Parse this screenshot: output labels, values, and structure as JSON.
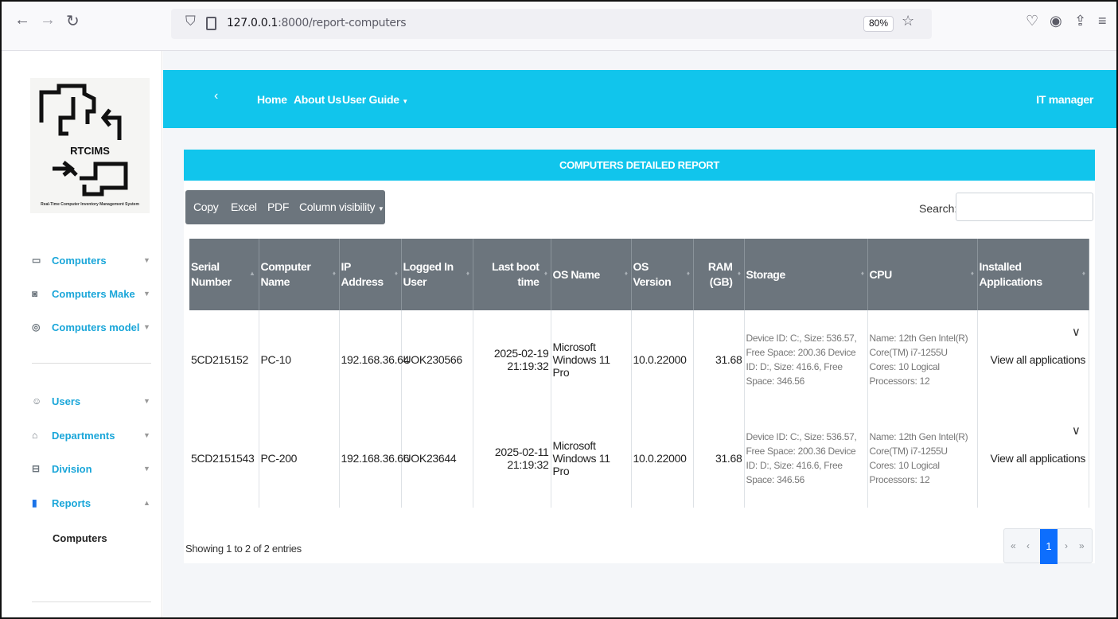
{
  "browser": {
    "url_host": "127.0.0.1",
    "url_path": ":8000/report-computers",
    "zoom": "80%"
  },
  "sidebar": {
    "logo_text": "RTCIMS",
    "logo_subtitle": "Real-Time Computer Inventory Management System",
    "items": [
      {
        "label": "Computers"
      },
      {
        "label": "Computers Make"
      },
      {
        "label": "Computers model"
      },
      {
        "label": "Users"
      },
      {
        "label": "Departments"
      },
      {
        "label": "Division"
      },
      {
        "label": "Reports"
      }
    ],
    "sub_item": "Computers"
  },
  "header": {
    "links": [
      "Home",
      "About Us",
      "User Guide"
    ],
    "user": "IT manager"
  },
  "report": {
    "title": "COMPUTERS DETAILED REPORT",
    "buttons": [
      "Copy",
      "Excel",
      "PDF",
      "Column visibility"
    ],
    "search_label": "Search:",
    "columns": [
      "Serial Number",
      "Computer Name",
      "IP Address",
      "Logged In User",
      "Last boot time",
      "OS Name",
      "OS Version",
      "RAM (GB)",
      "Storage",
      "CPU",
      "Installed Applications"
    ],
    "rows": [
      {
        "serial": "5CD215152",
        "name": "PC-10",
        "ip": "192.168.36.64",
        "user": "UOK230566",
        "boot_date": "2025-02-19",
        "boot_time": "21:19:32",
        "os_name": "Microsoft Windows 11 Pro",
        "os_version": "10.0.22000",
        "ram": "31.68",
        "storage": "Device ID: C:, Size: 536.57, Free Space: 200.36 Device ID: D:, Size: 416.6, Free Space: 346.56",
        "cpu": "Name: 12th Gen Intel(R) Core(TM) i7-1255U Cores: 10 Logical Processors: 12",
        "apps": "View all applications"
      },
      {
        "serial": "5CD2151543",
        "name": "PC-200",
        "ip": "192.168.36.66",
        "user": "UOK23644",
        "boot_date": "2025-02-11",
        "boot_time": "21:19:32",
        "os_name": "Microsoft Windows 11 Pro",
        "os_version": "10.0.22000",
        "ram": "31.68",
        "storage": "Device ID: C:, Size: 536.57, Free Space: 200.36 Device ID: D:, Size: 416.6, Free Space: 346.56",
        "cpu": "Name: 12th Gen Intel(R) Core(TM) i7-1255U Cores: 10 Logical Processors: 12",
        "apps": "View all applications"
      }
    ],
    "showing": "Showing 1 to 2 of 2 entries",
    "pager": {
      "first": "«",
      "prev": "‹",
      "current": "1",
      "next": "›",
      "last": "»"
    }
  }
}
